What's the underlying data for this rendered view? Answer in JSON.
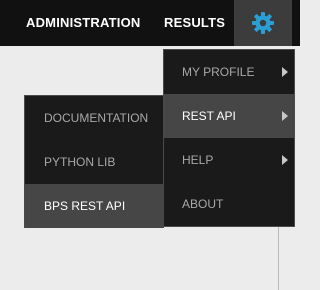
{
  "topbar": {
    "nav": [
      {
        "label": "ADMINISTRATION"
      },
      {
        "label": "RESULTS"
      }
    ],
    "settings_icon": "gear-icon",
    "settings_icon_color": "#2a9fd6"
  },
  "settings_menu": {
    "items": [
      {
        "label": "MY PROFILE",
        "has_submenu": true,
        "active": false
      },
      {
        "label": "REST API",
        "has_submenu": true,
        "active": true
      },
      {
        "label": "HELP",
        "has_submenu": true,
        "active": false
      },
      {
        "label": "ABOUT",
        "has_submenu": false,
        "active": false
      }
    ]
  },
  "rest_api_menu": {
    "items": [
      {
        "label": "DOCUMENTATION",
        "active": false
      },
      {
        "label": "PYTHON LIB",
        "active": false
      },
      {
        "label": "BPS REST API",
        "active": true
      }
    ]
  },
  "colors": {
    "topbar_bg": "#111111",
    "menu_bg": "#1a1a1a",
    "menu_active_bg": "#464646",
    "accent": "#2a9fd6"
  }
}
